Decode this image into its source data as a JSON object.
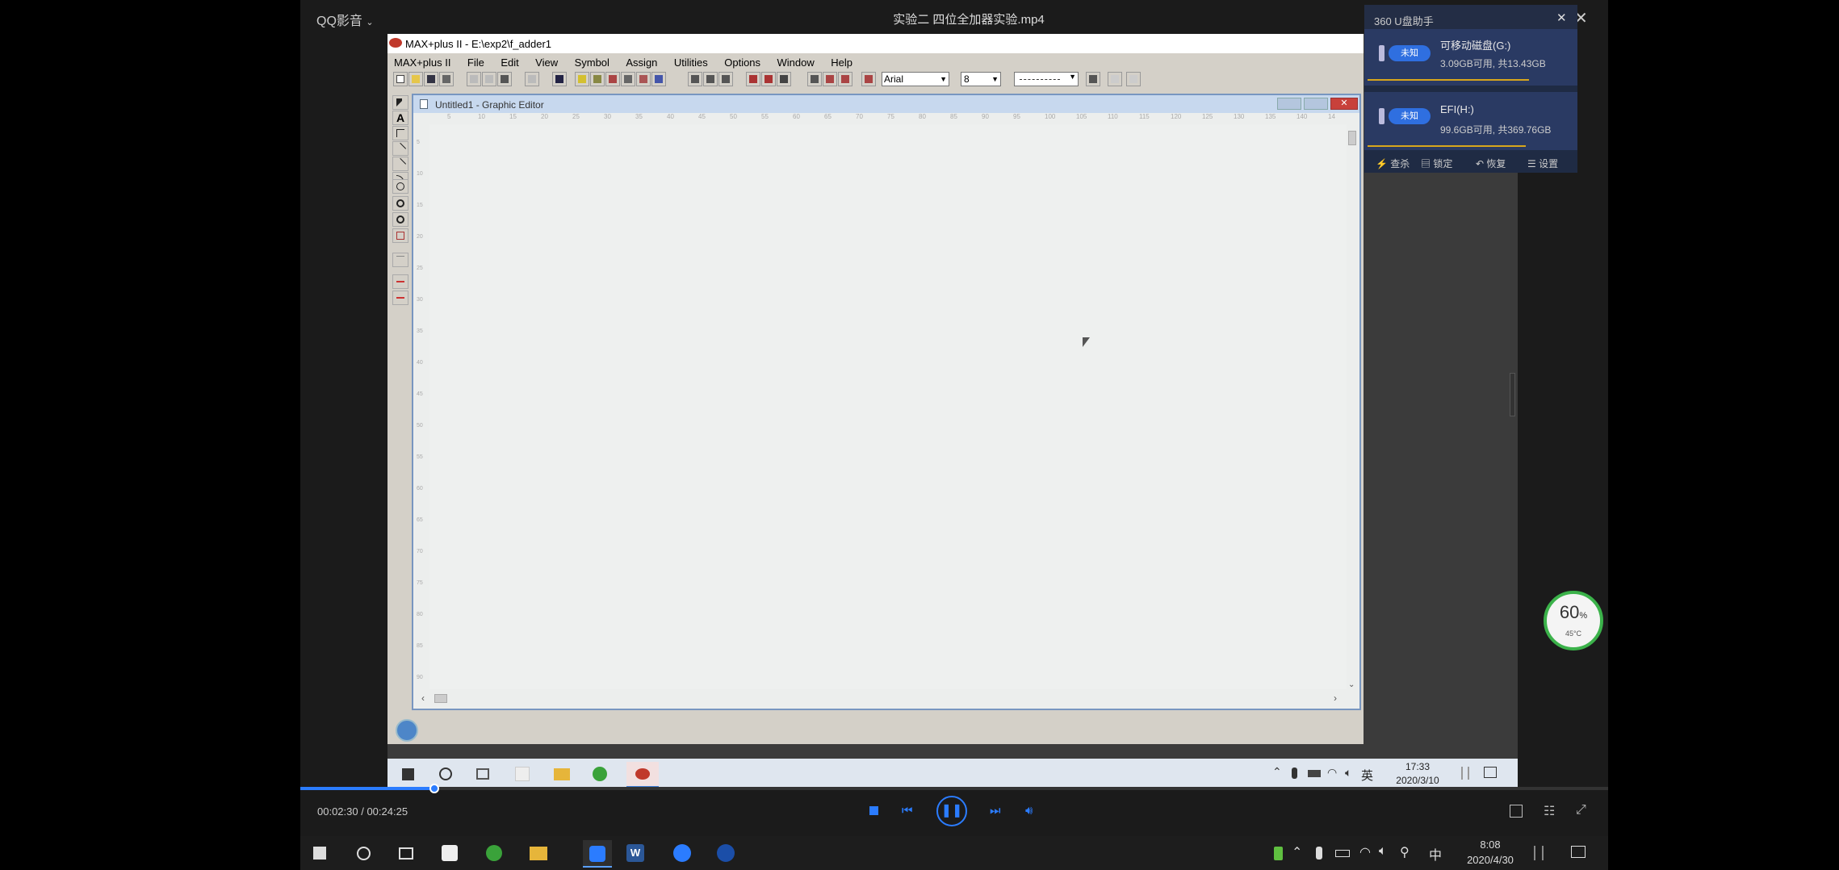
{
  "player": {
    "app_name": "QQ影音",
    "file_title": "实验二 四位全加器实验.mp4",
    "time": "00:02:30 / 00:24:25",
    "progress": 0.1024
  },
  "maxplus": {
    "window_title": "MAX+plus II - E:\\exp2\\f_adder1",
    "menu": [
      "MAX+plus II",
      "File",
      "Edit",
      "View",
      "Symbol",
      "Assign",
      "Utilities",
      "Options",
      "Window",
      "Help"
    ],
    "font_name": "Arial",
    "font_size": "8",
    "editor_title": "Untitled1 - Graphic Editor",
    "ruler_top": [
      "5",
      "10",
      "15",
      "20",
      "25",
      "30",
      "35",
      "40",
      "45",
      "50",
      "55",
      "60",
      "65",
      "70",
      "75",
      "80",
      "85",
      "90",
      "95",
      "100",
      "105",
      "110",
      "115",
      "120",
      "125",
      "130",
      "135",
      "140",
      "14"
    ],
    "ruler_left": [
      "5",
      "10",
      "15",
      "20",
      "25",
      "30",
      "35",
      "40",
      "45",
      "50",
      "55",
      "60",
      "65",
      "70",
      "75",
      "80",
      "85",
      "90"
    ]
  },
  "usb_helper": {
    "title": "360 U盘助手",
    "drives": [
      {
        "badge": "未知",
        "name": "可移动磁盘(G:)",
        "info": "3.09GB可用, 共13.43GB"
      },
      {
        "badge": "未知",
        "name": "EFI(H:)",
        "info": "99.6GB可用, 共369.76GB"
      }
    ],
    "actions": [
      "查杀",
      "锁定",
      "恢复",
      "设置"
    ]
  },
  "perf_widget": {
    "percent": "60",
    "unit": "%",
    "temp": "45°C"
  },
  "inner_taskbar": {
    "ime": "英",
    "time": "17:33",
    "date": "2020/3/10"
  },
  "outer_taskbar": {
    "ime": "中",
    "time": "8:08",
    "date": "2020/4/30"
  },
  "colors": {
    "accent": "#2b7cff",
    "maxplus_bg": "#d4d0c8",
    "editor_bg": "#eceeed",
    "title_blue": "#c7d8ee"
  }
}
